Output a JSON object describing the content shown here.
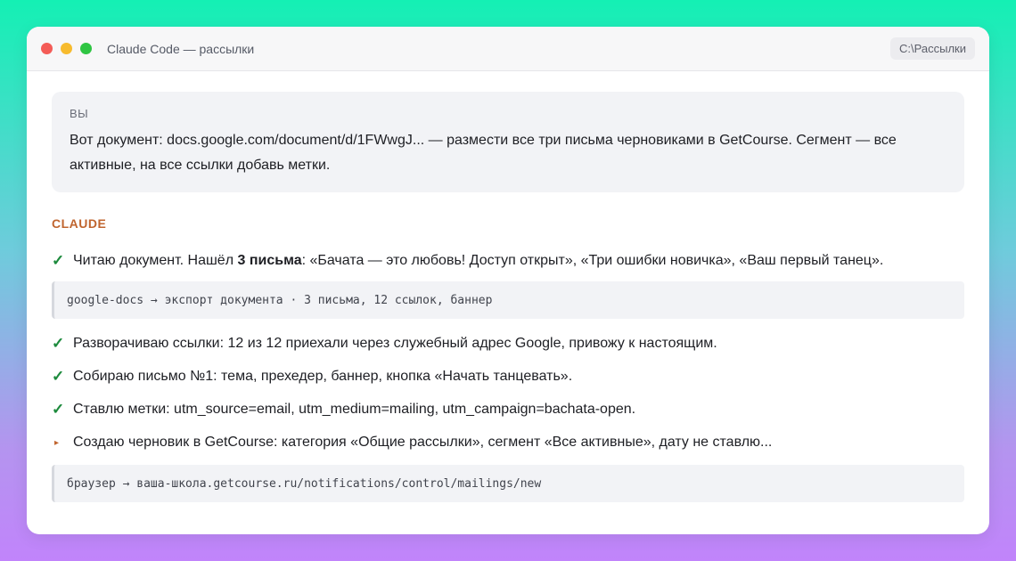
{
  "window": {
    "title": "Claude Code — рассылки",
    "path": "C:\\Рассылки"
  },
  "user": {
    "role": "ВЫ",
    "message": "Вот документ: docs.google.com/document/d/1FWwgJ... — размести все три письма черновиками в GetCourse. Сегмент — все активные, на все ссылки добавь метки."
  },
  "claude": {
    "label": "CLAUDE",
    "step1": {
      "mark": "✓",
      "before": "Читаю документ. Нашёл ",
      "bold": "3 письма",
      "after": ": «Бачата — это любовь! Доступ открыт», «Три ошибки новичка», «Ваш первый танец»."
    },
    "code1": "google-docs → экспорт документа · 3 письма, 12 ссылок, баннер",
    "step2": {
      "mark": "✓",
      "text": "Разворачиваю ссылки: 12 из 12 приехали через служебный адрес Google, привожу к настоящим."
    },
    "step3": {
      "mark": "✓",
      "text": "Собираю письмо №1: тема, прехедер, баннер, кнопка «Начать танцевать»."
    },
    "step4": {
      "mark": "✓",
      "text": "Ставлю метки: utm_source=email, utm_medium=mailing, utm_campaign=bachata-open."
    },
    "step5": {
      "mark": "▸",
      "text": "Создаю черновик в GetCourse: категория «Общие рассылки», сегмент «Все активные», дату не ставлю..."
    },
    "code2": "браузер → ваша-школа.getcourse.ru/notifications/control/mailings/new"
  },
  "colors": {
    "accent": "#c0652f",
    "check": "#1c8a3c",
    "close": "#f45c57",
    "minimize": "#f7bb2e",
    "maximize": "#2fc543"
  }
}
